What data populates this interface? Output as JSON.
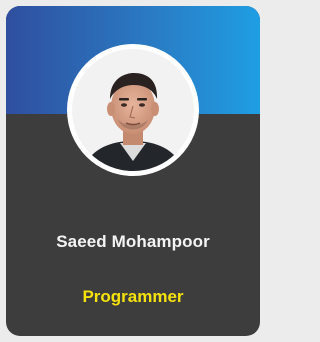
{
  "profile": {
    "name": "Saeed Mohampoor",
    "role": "Programmer"
  },
  "colors": {
    "header_gradient_start": "#2f4f9f",
    "header_gradient_end": "#1f9ee3",
    "card_background": "#3d3d3d",
    "name_text": "#f4f4f4",
    "role_text": "#f5e20c",
    "avatar_border": "#ffffff"
  }
}
